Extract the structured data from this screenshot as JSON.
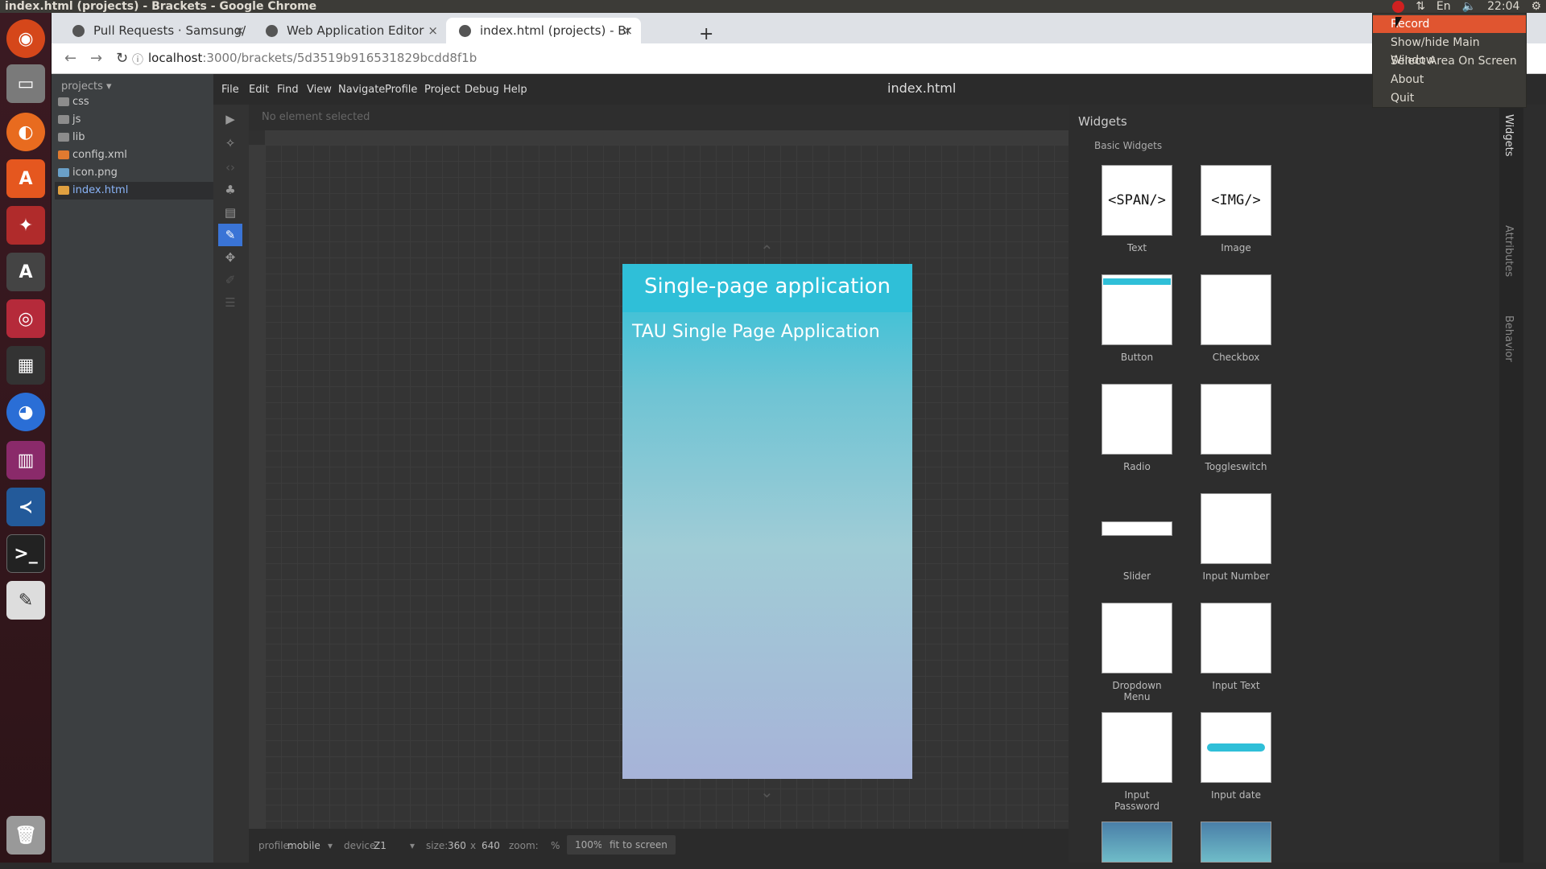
{
  "window_title": "index.html (projects) - Brackets - Google Chrome",
  "tray": {
    "clock": "22:04",
    "lang": "En"
  },
  "tray_menu": [
    "Record",
    "Show/hide Main Window",
    "Select Area On Screen",
    "About",
    "Quit"
  ],
  "chrome": {
    "tabs": [
      {
        "label": "Pull Requests · Samsung/",
        "close": "×"
      },
      {
        "label": "Web Application Editor",
        "close": "×"
      },
      {
        "label": "index.html (projects) - Br",
        "close": "×"
      }
    ],
    "new_tab": "+",
    "url_host": "localhost",
    "url_path": ":3000/brackets/5d3519b916531829bcdd8f1b"
  },
  "brackets": {
    "project_label": "projects ▾",
    "files": [
      "css",
      "js",
      "lib",
      "config.xml",
      "icon.png",
      "index.html"
    ],
    "menu": [
      "File",
      "Edit",
      "Find",
      "View",
      "Navigate",
      "Profile",
      "Project",
      "Debug",
      "Help"
    ],
    "doc_title": "index.html",
    "selection": "No element selected",
    "device_header": "Single-page application",
    "device_content": "TAU Single Page Application",
    "status": {
      "profile_label": "profile:",
      "profile": "mobile",
      "device_label": "device:",
      "device": "Z1",
      "size_label": "size:",
      "size_w": "360",
      "size_x": "x",
      "size_h": "640",
      "zoom_label": "zoom:",
      "zoom_unit": "%",
      "zoom_value": "100%",
      "fit": "fit to screen"
    }
  },
  "widgets": {
    "title": "Widgets",
    "group": "Basic Widgets",
    "items": [
      {
        "label": "Text",
        "thumb": "<SPAN/>"
      },
      {
        "label": "Image",
        "thumb": "<IMG/>"
      },
      {
        "label": "Button",
        "thumb": ""
      },
      {
        "label": "Checkbox",
        "thumb": ""
      },
      {
        "label": "Radio",
        "thumb": ""
      },
      {
        "label": "Toggleswitch",
        "thumb": ""
      },
      {
        "label": "Slider",
        "thumb": ""
      },
      {
        "label": "Input Number",
        "thumb": ""
      },
      {
        "label": "Dropdown Menu",
        "thumb": ""
      },
      {
        "label": "Input Text",
        "thumb": ""
      },
      {
        "label": "Input Password",
        "thumb": ""
      },
      {
        "label": "Input date",
        "thumb": ""
      }
    ],
    "side_tabs": [
      "Widgets",
      "Attributes",
      "Behavior"
    ]
  }
}
